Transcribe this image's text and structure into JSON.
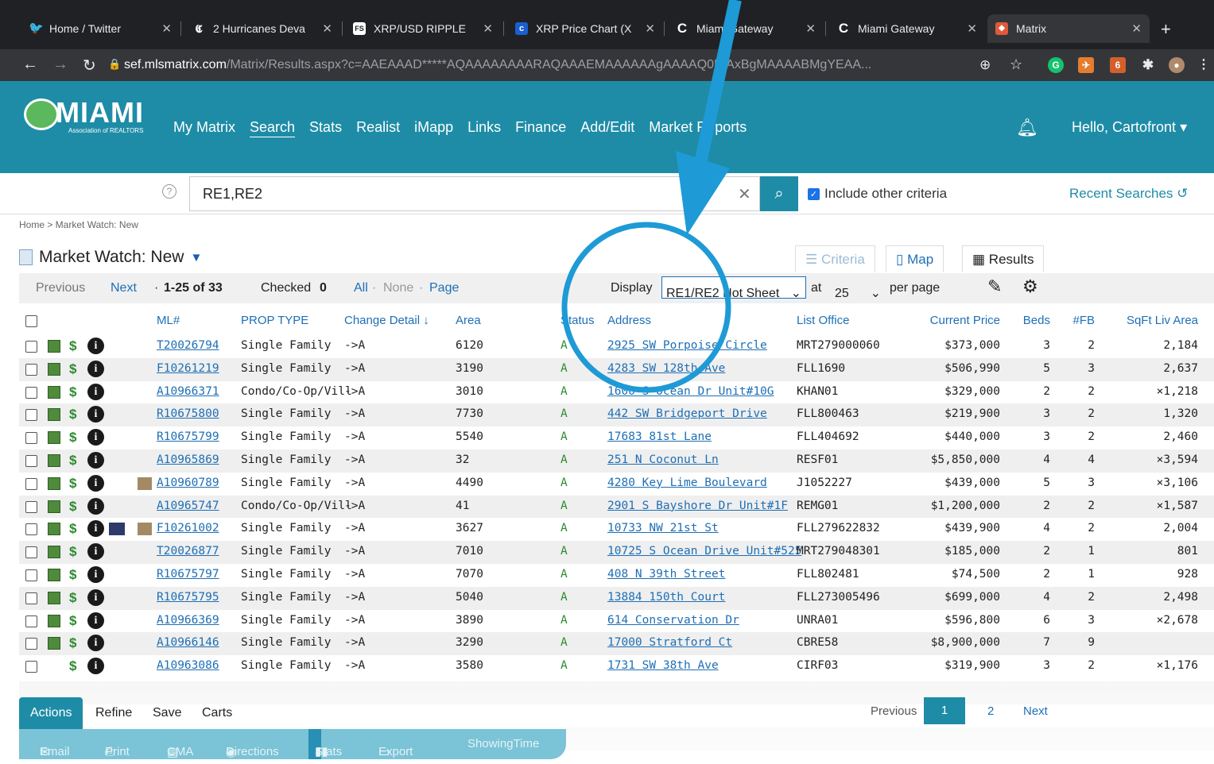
{
  "browser": {
    "tabs": [
      {
        "label": "Home / Twitter",
        "icon": "twitter-icon",
        "color": "#1da1f2"
      },
      {
        "label": "2 Hurricanes Deva",
        "icon": "newspaper-icon",
        "color": "#ffffff"
      },
      {
        "label": "XRP/USD RIPPLE",
        "icon": "fxs-icon",
        "color": "#ffffff"
      },
      {
        "label": "XRP Price Chart (X",
        "icon": "coin-icon",
        "color": "#1a5fd0"
      },
      {
        "label": "Miami Gateway",
        "icon": "c-logo-icon",
        "color": "#ffffff"
      },
      {
        "label": "Miami Gateway",
        "icon": "c-logo-icon",
        "color": "#ffffff"
      },
      {
        "label": "Matrix",
        "icon": "matrix-icon",
        "color": "#e05a3a"
      }
    ],
    "url_host": "sef.mlsmatrix.com",
    "url_path": "/Matrix/Results.aspx?c=AAEAAAD*****AQAAAAAAAARAQAAAEMAAAAAAgAAAAQ0NjAxBgMAAAABMgYEAA..."
  },
  "site": {
    "logo_text": "MIAMI",
    "logo_sub": "Association of REALTORS",
    "nav": [
      "My Matrix",
      "Search",
      "Stats",
      "Realist",
      "iMapp",
      "Links",
      "Finance",
      "Add/Edit",
      "Market Reports"
    ],
    "greeting": "Hello, Cartofront"
  },
  "search": {
    "help": "?",
    "value": "RE1,RE2",
    "include_label": "Include other criteria",
    "recent_label": "Recent Searches"
  },
  "breadcrumb": "Home > Market Watch: New",
  "page_title": "Market Watch: New",
  "view_tabs": {
    "criteria": "Criteria",
    "map": "Map",
    "results": "Results"
  },
  "controls": {
    "previous": "Previous",
    "next": "Next",
    "range": "1-25 of 33",
    "range_prefix": "·",
    "checked_label": "Checked",
    "checked_count": "0",
    "all": "All",
    "none": "None",
    "page": "Page",
    "display_label": "Display",
    "display_value": "RE1/RE2 Hot Sheet",
    "at_label": "at",
    "per_page_value": "25",
    "per_page_label": "per page"
  },
  "table": {
    "headers": {
      "ml": "ML#",
      "prop_type": "PROP TYPE",
      "change": "Change Detail",
      "area": "Area",
      "status": "Status",
      "address": "Address",
      "office": "List Office",
      "price": "Current Price",
      "beds": "Beds",
      "fb": "#FB",
      "sqft": "SqFt Liv Area"
    },
    "rows": [
      {
        "ml": "T20026794",
        "type": "Single Family",
        "change": "->A",
        "area": "6120",
        "status": "A",
        "address": "2925 SW Porpoise Circle",
        "office": "MRT279000060",
        "price": "$373,000",
        "beds": "3",
        "fb": "2",
        "sqft": "2,184"
      },
      {
        "ml": "F10261219",
        "type": "Single Family",
        "change": "->A",
        "area": "3190",
        "status": "A",
        "address": "4283 SW 128th Ave",
        "office": "FLL1690",
        "price": "$506,990",
        "beds": "5",
        "fb": "3",
        "sqft": "2,637"
      },
      {
        "ml": "A10966371",
        "type": "Condo/Co-Op/Vill",
        "change": "->A",
        "area": "3010",
        "status": "A",
        "address": "1600 S Ocean Dr Unit#10G",
        "office": "KHAN01",
        "price": "$329,000",
        "beds": "2",
        "fb": "2",
        "sqft": "×1,218"
      },
      {
        "ml": "R10675800",
        "type": "Single Family",
        "change": "->A",
        "area": "7730",
        "status": "A",
        "address": "442 SW Bridgeport Drive",
        "office": "FLL800463",
        "price": "$219,900",
        "beds": "3",
        "fb": "2",
        "sqft": "1,320"
      },
      {
        "ml": "R10675799",
        "type": "Single Family",
        "change": "->A",
        "area": "5540",
        "status": "A",
        "address": "17683 81st Lane",
        "office": "FLL404692",
        "price": "$440,000",
        "beds": "3",
        "fb": "2",
        "sqft": "2,460"
      },
      {
        "ml": "A10965869",
        "type": "Single Family",
        "change": "->A",
        "area": "32",
        "status": "A",
        "address": "251 N Coconut Ln",
        "office": "RESF01",
        "price": "$5,850,000",
        "beds": "4",
        "fb": "4",
        "sqft": "×3,594"
      },
      {
        "ml": "A10960789",
        "type": "Single Family",
        "change": "->A",
        "area": "4490",
        "status": "A",
        "address": "4280 Key Lime Boulevard",
        "office": "J1052227",
        "price": "$439,000",
        "beds": "5",
        "fb": "3",
        "sqft": "×3,106"
      },
      {
        "ml": "A10965747",
        "type": "Condo/Co-Op/Vill",
        "change": "->A",
        "area": "41",
        "status": "A",
        "address": "2901 S Bayshore Dr Unit#1F",
        "office": "REMG01",
        "price": "$1,200,000",
        "beds": "2",
        "fb": "2",
        "sqft": "×1,587"
      },
      {
        "ml": "F10261002",
        "type": "Single Family",
        "change": "->A",
        "area": "3627",
        "status": "A",
        "address": "10733 NW 21st St",
        "office": "FLL279622832",
        "price": "$439,900",
        "beds": "4",
        "fb": "2",
        "sqft": "2,004"
      },
      {
        "ml": "T20026877",
        "type": "Single Family",
        "change": "->A",
        "area": "7010",
        "status": "A",
        "address": "10725 S Ocean Drive Unit#525",
        "office": "MRT279048301",
        "price": "$185,000",
        "beds": "2",
        "fb": "1",
        "sqft": "801"
      },
      {
        "ml": "R10675797",
        "type": "Single Family",
        "change": "->A",
        "area": "7070",
        "status": "A",
        "address": "408 N 39th Street",
        "office": "FLL802481",
        "price": "$74,500",
        "beds": "2",
        "fb": "1",
        "sqft": "928"
      },
      {
        "ml": "R10675795",
        "type": "Single Family",
        "change": "->A",
        "area": "5040",
        "status": "A",
        "address": "13884 150th Court",
        "office": "FLL273005496",
        "price": "$699,000",
        "beds": "4",
        "fb": "2",
        "sqft": "2,498"
      },
      {
        "ml": "A10966369",
        "type": "Single Family",
        "change": "->A",
        "area": "3890",
        "status": "A",
        "address": "614 Conservation Dr",
        "office": "UNRA01",
        "price": "$596,800",
        "beds": "6",
        "fb": "3",
        "sqft": "×2,678"
      },
      {
        "ml": "A10966146",
        "type": "Single Family",
        "change": "->A",
        "area": "3290",
        "status": "A",
        "address": "17000 Stratford Ct",
        "office": "CBRE58",
        "price": "$8,900,000",
        "beds": "7",
        "fb": "9",
        "sqft": ""
      },
      {
        "ml": "A10963086",
        "type": "Single Family",
        "change": "->A",
        "area": "3580",
        "status": "A",
        "address": "1731 SW 38th Ave",
        "office": "CIRF03",
        "price": "$319,900",
        "beds": "3",
        "fb": "2",
        "sqft": "×1,176"
      }
    ]
  },
  "bottom": {
    "tabs": [
      "Actions",
      "Refine",
      "Save",
      "Carts"
    ],
    "actions": [
      "Email",
      "Print",
      "CMA",
      "Directions",
      "Stats",
      "Export",
      "ShowingTime"
    ],
    "pager_prev": "Previous",
    "pager_pages": [
      "1",
      "2"
    ],
    "pager_next": "Next"
  },
  "annotation_color": "#1e9ad6"
}
